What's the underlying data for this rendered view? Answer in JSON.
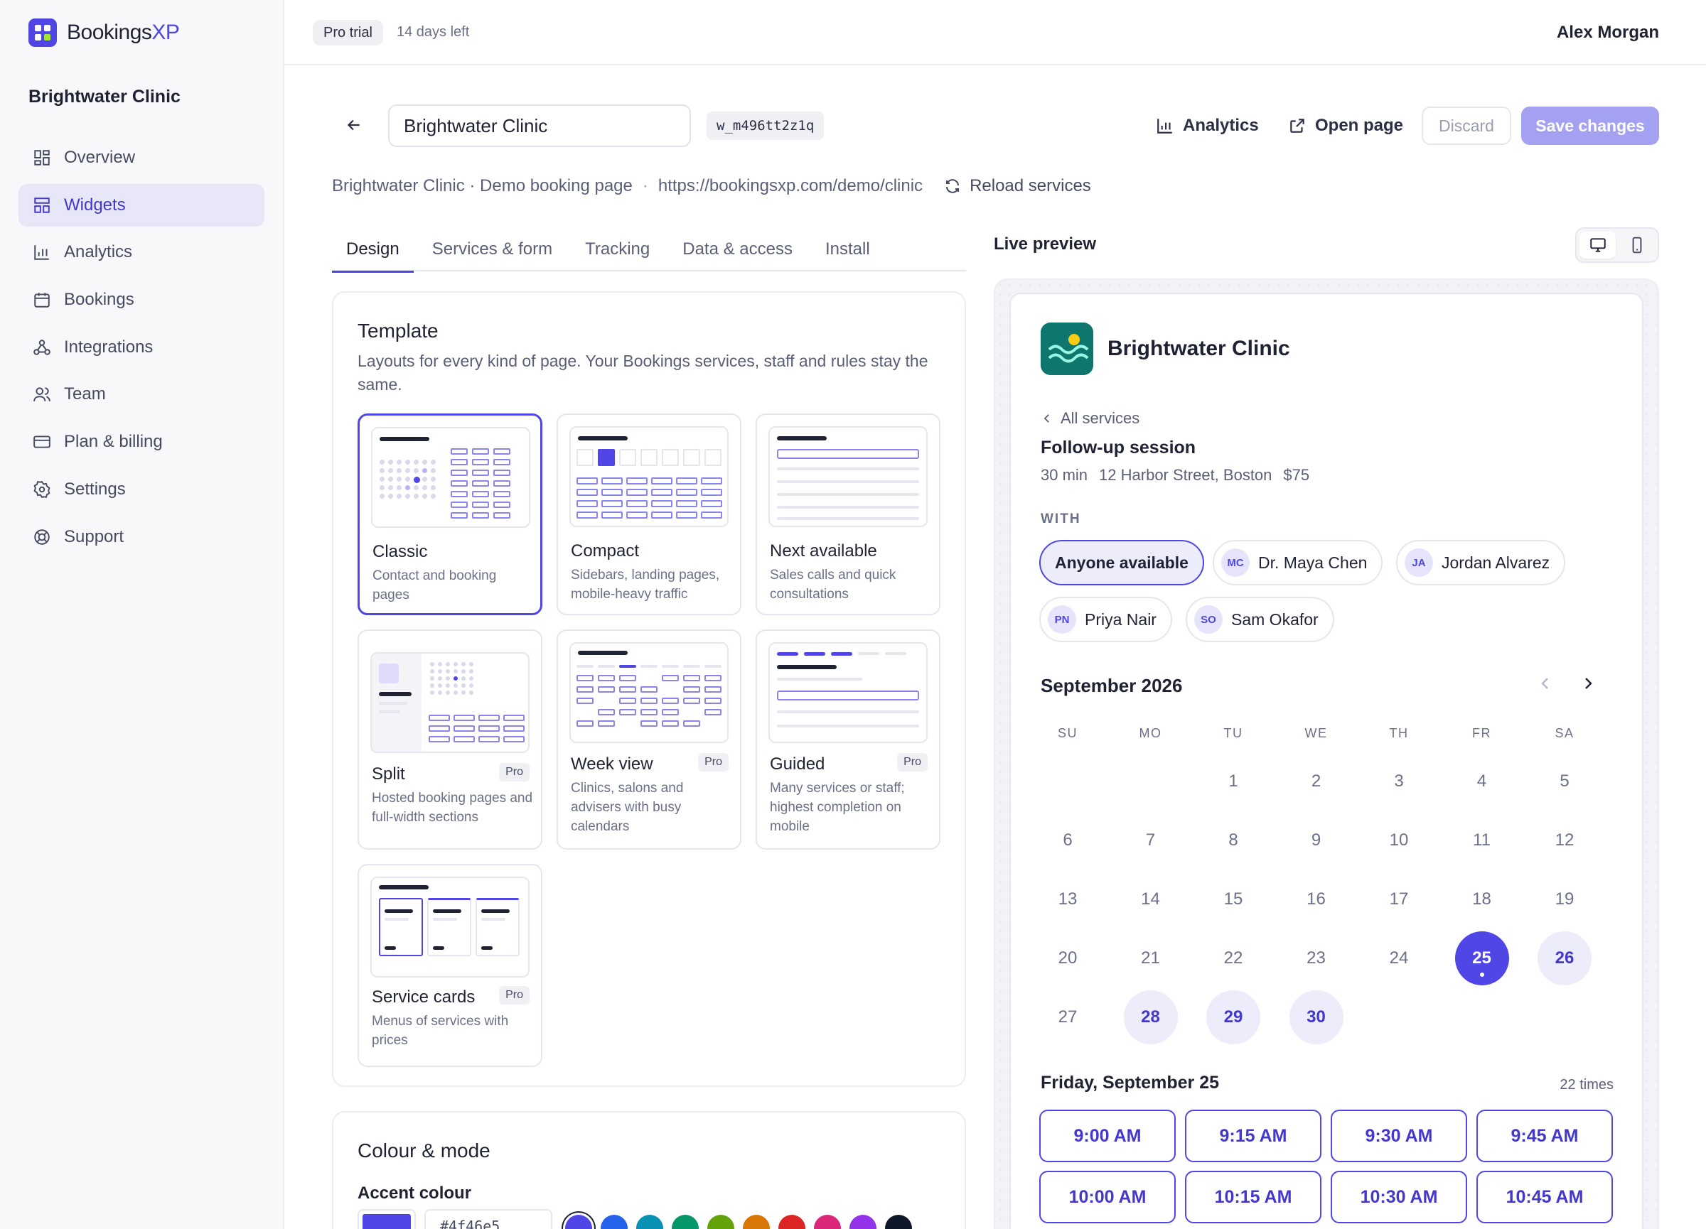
{
  "brand": {
    "name_main": "Bookings",
    "name_accent": "XP"
  },
  "sidebar": {
    "workspace": "Brightwater Clinic",
    "items": [
      {
        "label": "Overview",
        "icon": "grid-icon",
        "active": false
      },
      {
        "label": "Widgets",
        "icon": "layout-icon",
        "active": true
      },
      {
        "label": "Analytics",
        "icon": "bar-chart-icon",
        "active": false
      },
      {
        "label": "Bookings",
        "icon": "calendar-icon",
        "active": false
      },
      {
        "label": "Integrations",
        "icon": "webhook-icon",
        "active": false
      },
      {
        "label": "Team",
        "icon": "users-icon",
        "active": false
      },
      {
        "label": "Plan & billing",
        "icon": "credit-card-icon",
        "active": false
      },
      {
        "label": "Settings",
        "icon": "gear-icon",
        "active": false
      },
      {
        "label": "Support",
        "icon": "lifebuoy-icon",
        "active": false
      }
    ]
  },
  "topbar": {
    "trial_badge": "Pro trial",
    "trial_left": "14 days left",
    "user": "Alex Morgan"
  },
  "header": {
    "widget_name": "Brightwater Clinic",
    "widget_id": "w_m496tt2z1q",
    "analytics": "Analytics",
    "open_page": "Open page",
    "discard": "Discard",
    "save": "Save changes"
  },
  "subheader": {
    "title": "Brightwater Clinic · Demo booking page",
    "separator": "·",
    "url": "https://bookingsxp.com/demo/clinic",
    "reload": "Reload services"
  },
  "tabs": [
    {
      "label": "Design",
      "active": true
    },
    {
      "label": "Services & form",
      "active": false
    },
    {
      "label": "Tracking",
      "active": false
    },
    {
      "label": "Data & access",
      "active": false
    },
    {
      "label": "Install",
      "active": false
    }
  ],
  "template_section": {
    "title": "Template",
    "description": "Layouts for every kind of page. Your Bookings services, staff and rules stay the same.",
    "templates": [
      {
        "name": "Classic",
        "desc": "Contact and booking pages",
        "pro": false,
        "selected": true
      },
      {
        "name": "Compact",
        "desc": "Sidebars, landing pages, mobile-heavy traffic",
        "pro": false,
        "selected": false
      },
      {
        "name": "Next available",
        "desc": "Sales calls and quick consultations",
        "pro": false,
        "selected": false
      },
      {
        "name": "Split",
        "desc": "Hosted booking pages and full-width sections",
        "pro": true,
        "selected": false
      },
      {
        "name": "Week view",
        "desc": "Clinics, salons and advisers with busy calendars",
        "pro": true,
        "selected": false
      },
      {
        "name": "Guided",
        "desc": "Many services or staff; highest completion on mobile",
        "pro": true,
        "selected": false
      },
      {
        "name": "Service cards",
        "desc": "Menus of services with prices",
        "pro": true,
        "selected": false
      }
    ],
    "pro_label": "Pro"
  },
  "colour_section": {
    "title": "Colour & mode",
    "accent_label": "Accent colour",
    "accent_hex": "#4f46e5",
    "swatches": [
      "#4f46e5",
      "#2563eb",
      "#0891b2",
      "#059669",
      "#65a30d",
      "#d97706",
      "#dc2626",
      "#db2777",
      "#9333ea",
      "#0f172a"
    ]
  },
  "preview": {
    "title": "Live preview",
    "business": "Brightwater Clinic",
    "back": "All services",
    "service": "Follow-up session",
    "duration": "30 min",
    "location": "12 Harbor Street, Boston",
    "price": "$75",
    "with_label": "WITH",
    "staff": [
      {
        "label": "Anyone available",
        "initials": "",
        "selected": true
      },
      {
        "label": "Dr. Maya Chen",
        "initials": "MC",
        "selected": false
      },
      {
        "label": "Jordan Alvarez",
        "initials": "JA",
        "selected": false
      },
      {
        "label": "Priya Nair",
        "initials": "PN",
        "selected": false
      },
      {
        "label": "Sam Okafor",
        "initials": "SO",
        "selected": false
      }
    ],
    "month": "September 2026",
    "weekdays": [
      "SU",
      "MO",
      "TU",
      "WE",
      "TH",
      "FR",
      "SA"
    ],
    "first_weekday": 2,
    "days_in_month": 30,
    "available_days": [
      25,
      26,
      28,
      29,
      30
    ],
    "selected_day": 25,
    "slots_title": "Friday, September 25",
    "slots_count": "22 times",
    "slots": [
      "9:00 AM",
      "9:15 AM",
      "9:30 AM",
      "9:45 AM",
      "10:00 AM",
      "10:15 AM",
      "10:30 AM",
      "10:45 AM"
    ]
  },
  "colors": {
    "accent": "#4f46e5",
    "accent_soft": "#ececfb",
    "save_disabled": "#a5a1f2"
  }
}
